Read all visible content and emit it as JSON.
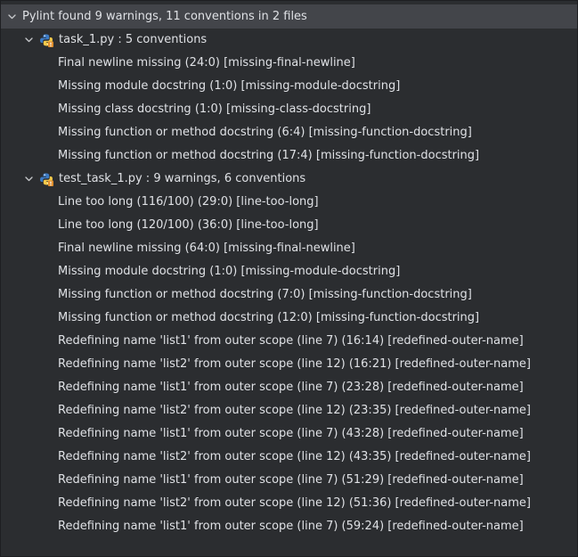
{
  "root": {
    "label": "Pylint found 9 warnings, 11 conventions  in 2 files",
    "expanded": true
  },
  "colors": {
    "background": "#2b2d30",
    "selection": "#43454a",
    "text": "#dfe1e5",
    "python_blue": "#3d7bc4",
    "python_yellow": "#f3c94a",
    "warning_badge": "#e08f2f"
  },
  "files": [
    {
      "icon": "python-file-icon",
      "label": "task_1.py : 5 conventions",
      "expanded": true,
      "items": [
        "Final newline missing (24:0) [missing-final-newline]",
        "Missing module docstring (1:0) [missing-module-docstring]",
        "Missing class docstring (1:0) [missing-class-docstring]",
        "Missing function or method docstring (6:4) [missing-function-docstring]",
        "Missing function or method docstring (17:4) [missing-function-docstring]"
      ]
    },
    {
      "icon": "python-file-icon",
      "label": "test_task_1.py : 9 warnings, 6 conventions",
      "expanded": true,
      "items": [
        "Line too long (116/100) (29:0) [line-too-long]",
        "Line too long (120/100) (36:0) [line-too-long]",
        "Final newline missing (64:0) [missing-final-newline]",
        "Missing module docstring (1:0) [missing-module-docstring]",
        "Missing function or method docstring (7:0) [missing-function-docstring]",
        "Missing function or method docstring (12:0) [missing-function-docstring]",
        "Redefining name 'list1' from outer scope (line 7) (16:14) [redefined-outer-name]",
        "Redefining name 'list2' from outer scope (line 12) (16:21) [redefined-outer-name]",
        "Redefining name 'list1' from outer scope (line 7) (23:28) [redefined-outer-name]",
        "Redefining name 'list2' from outer scope (line 12) (23:35) [redefined-outer-name]",
        "Redefining name 'list1' from outer scope (line 7) (43:28) [redefined-outer-name]",
        "Redefining name 'list2' from outer scope (line 12) (43:35) [redefined-outer-name]",
        "Redefining name 'list1' from outer scope (line 7) (51:29) [redefined-outer-name]",
        "Redefining name 'list2' from outer scope (line 12) (51:36) [redefined-outer-name]",
        "Redefining name 'list1' from outer scope (line 7) (59:24) [redefined-outer-name]"
      ]
    }
  ]
}
